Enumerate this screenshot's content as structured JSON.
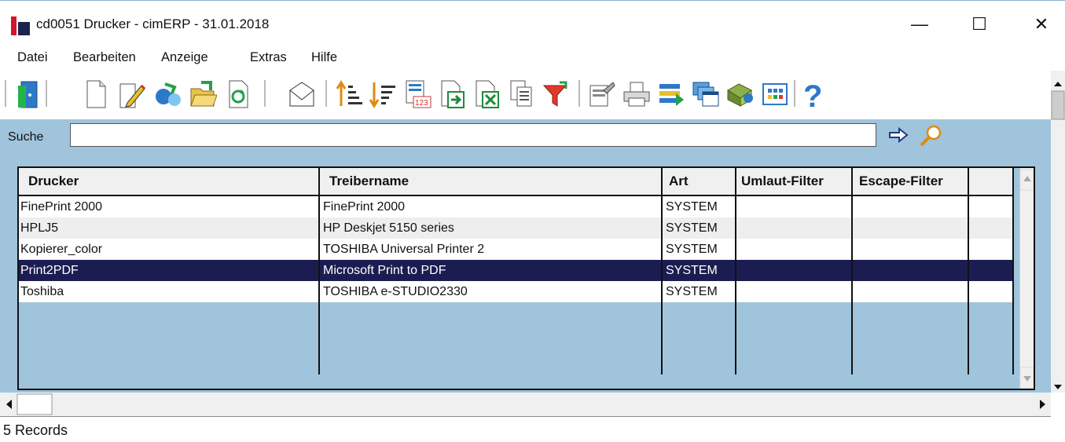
{
  "window": {
    "title": "cd0051 Drucker - cimERP - 31.01.2018",
    "controls": {
      "minimize": "—",
      "maximize": "☐",
      "close": "✕"
    }
  },
  "menu": [
    "Datei",
    "Bearbeiten",
    "Anzeige",
    "Extras",
    "Hilfe"
  ],
  "toolbar": {
    "icons": [
      "exit-door-icon",
      "new-document-icon",
      "edit-pencil-icon",
      "copy-record-icon",
      "open-folder-icon",
      "refresh-icon",
      "email-icon",
      "sort-ascending-icon",
      "sort-descending-icon",
      "numbering-icon",
      "export-icon",
      "excel-export-icon",
      "copy-pages-icon",
      "filter-icon",
      "properties-icon",
      "print-icon",
      "transfer-icon",
      "windows-icon",
      "archive-icon",
      "calculator-icon",
      "help-icon"
    ]
  },
  "search": {
    "label": "Suche",
    "value": "",
    "placeholder": ""
  },
  "grid": {
    "columns": [
      "Drucker",
      "Treibername",
      "Art",
      "Umlaut-Filter",
      "Escape-Filter"
    ],
    "rows": [
      {
        "drucker": "FinePrint 2000",
        "treiber": "FinePrint 2000",
        "art": "SYSTEM",
        "umlaut": "",
        "escape": ""
      },
      {
        "drucker": "HPLJ5",
        "treiber": "HP Deskjet 5150 series",
        "art": "SYSTEM",
        "umlaut": "",
        "escape": ""
      },
      {
        "drucker": "Kopierer_color",
        "treiber": "TOSHIBA Universal Printer 2",
        "art": "SYSTEM",
        "umlaut": "",
        "escape": ""
      },
      {
        "drucker": "Print2PDF",
        "treiber": "Microsoft Print to PDF",
        "art": "SYSTEM",
        "umlaut": "",
        "escape": ""
      },
      {
        "drucker": "Toshiba",
        "treiber": "TOSHIBA e-STUDIO2330",
        "art": "SYSTEM",
        "umlaut": "",
        "escape": ""
      }
    ],
    "selected_row": "Print2PDF"
  },
  "status": {
    "text": "5 Records"
  },
  "colors": {
    "accent_blue": "#a0c4dc",
    "selection": "#1b1d52"
  }
}
